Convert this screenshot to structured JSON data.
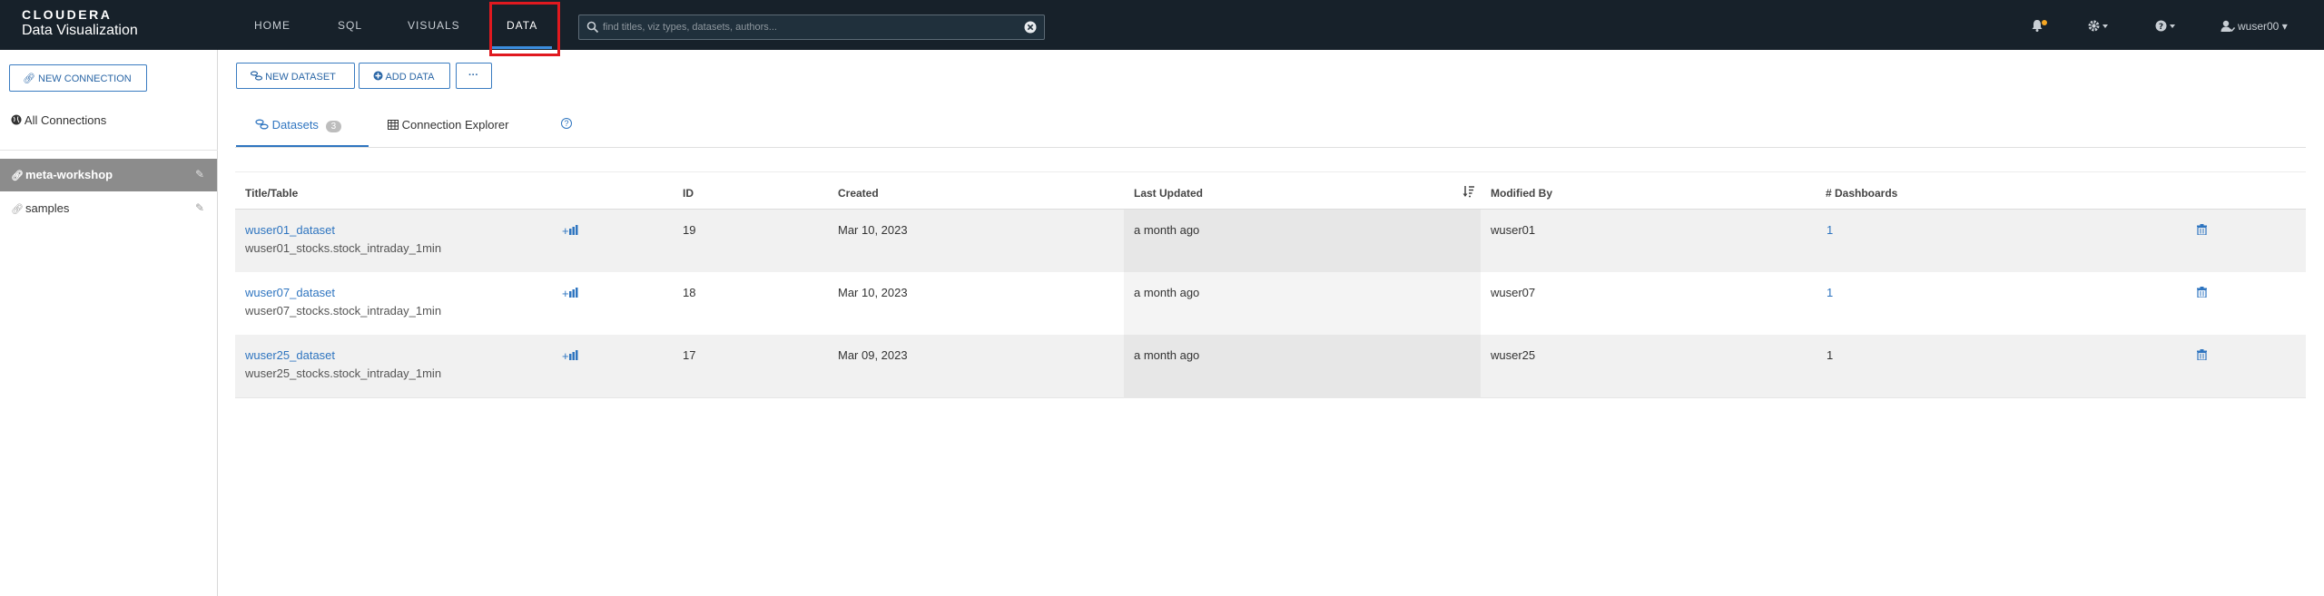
{
  "logo": {
    "brand": "CLOUDERA",
    "product": "Data Visualization"
  },
  "nav": [
    {
      "label": "HOME"
    },
    {
      "label": "SQL"
    },
    {
      "label": "VISUALS"
    },
    {
      "label": "DATA"
    }
  ],
  "search": {
    "placeholder": "find titles, viz types, datasets, authors..."
  },
  "user": {
    "name": "wuser00"
  },
  "sidebar": {
    "new_connection": "NEW CONNECTION",
    "all_connections": "All Connections",
    "connections": [
      {
        "label": "meta-workshop"
      },
      {
        "label": "samples"
      }
    ]
  },
  "toolbar": {
    "new_dataset": "NEW DATASET",
    "add_data": "ADD DATA",
    "more": "···"
  },
  "tabs": {
    "datasets": "Datasets",
    "datasets_count": "3",
    "connection_explorer": "Connection Explorer"
  },
  "table": {
    "headers": [
      "Title/Table",
      "ID",
      "Created",
      "Last Updated",
      "Modified By",
      "# Dashboards"
    ],
    "rows": [
      {
        "title": "wuser01_dataset",
        "table": "wuser01_stocks.stock_intraday_1min",
        "id": "19",
        "created": "Mar 10, 2023",
        "updated": "a month ago",
        "modified_by": "wuser01",
        "dashboards": "1"
      },
      {
        "title": "wuser07_dataset",
        "table": "wuser07_stocks.stock_intraday_1min",
        "id": "18",
        "created": "Mar 10, 2023",
        "updated": "a month ago",
        "modified_by": "wuser07",
        "dashboards": "1"
      },
      {
        "title": "wuser25_dataset",
        "table": "wuser25_stocks.stock_intraday_1min",
        "id": "17",
        "created": "Mar 09, 2023",
        "updated": "a month ago",
        "modified_by": "wuser25",
        "dashboards": "1"
      }
    ]
  },
  "colors": {
    "topbar": "#17212a",
    "accent": "#2f75c0",
    "highlight": "#e0191f"
  }
}
